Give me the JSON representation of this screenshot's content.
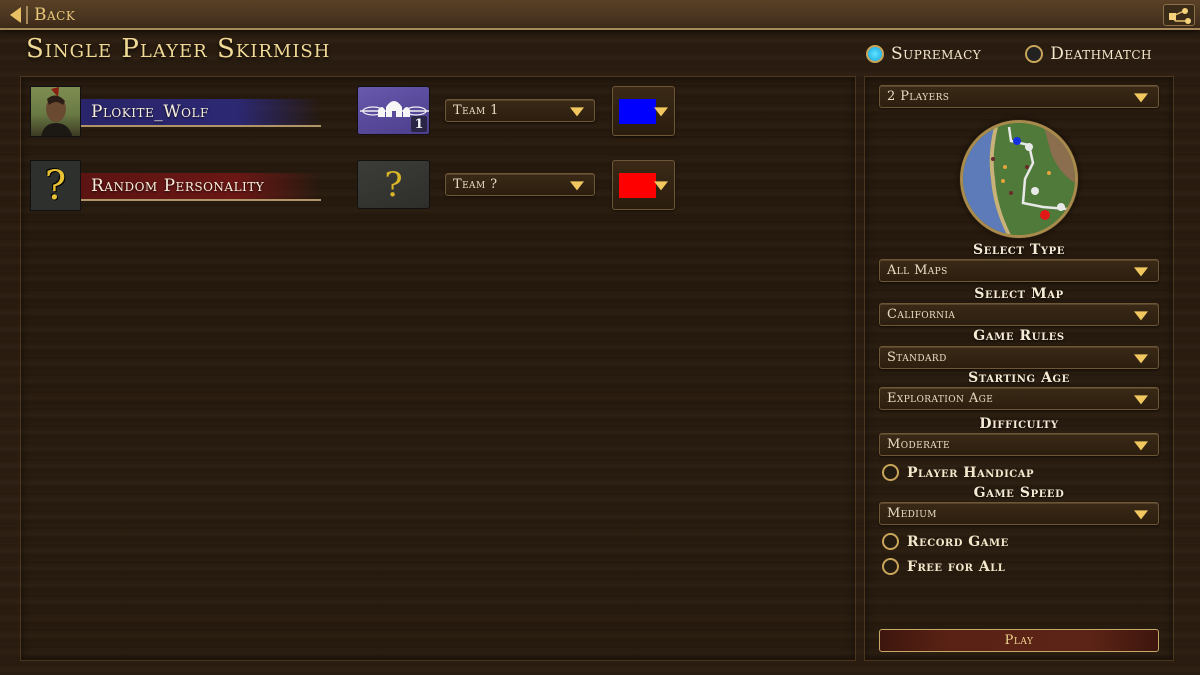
{
  "topbar": {
    "back_label": "Back",
    "network_icon": "network-icon"
  },
  "page_title": "Single Player Skirmish",
  "game_mode": {
    "options": [
      {
        "label": "Supremacy",
        "selected": true
      },
      {
        "label": "Deathmatch",
        "selected": false
      }
    ]
  },
  "players": [
    {
      "name": "Plokite_Wolf",
      "avatar": "portrait-avatar",
      "name_bar_color": "#2c2872",
      "civ_icon": "tribal-lodge-icon",
      "civ_number": "1",
      "team": "Team 1",
      "color": "#0000ff"
    },
    {
      "name": "Random Personality",
      "avatar": "question-mark-avatar",
      "name_bar_color": "#6a1715",
      "civ_icon": "question-mark-icon",
      "civ_glyph": "?",
      "team": "Team ?",
      "color": "#ff0000"
    }
  ],
  "settings": {
    "player_count": "2 Players",
    "select_type": {
      "label": "Select Type",
      "value": "All Maps"
    },
    "select_map": {
      "label": "Select Map",
      "value": "California"
    },
    "game_rules": {
      "label": "Game Rules",
      "value": "Standard"
    },
    "starting_age": {
      "label": "Starting Age",
      "value": "Exploration Age"
    },
    "difficulty": {
      "label": "Difficulty",
      "value": "Moderate"
    },
    "player_handicap": {
      "label": "Player Handicap",
      "checked": false
    },
    "game_speed": {
      "label": "Game Speed",
      "value": "Medium"
    },
    "record_game": {
      "label": "Record Game",
      "checked": false
    },
    "free_for_all": {
      "label": "Free for All",
      "checked": false
    }
  },
  "play_label": "Play",
  "colors": {
    "accent_gold": "#f1c85f",
    "radio_active": "#2bb7e8",
    "play_button": "#5a2214"
  }
}
